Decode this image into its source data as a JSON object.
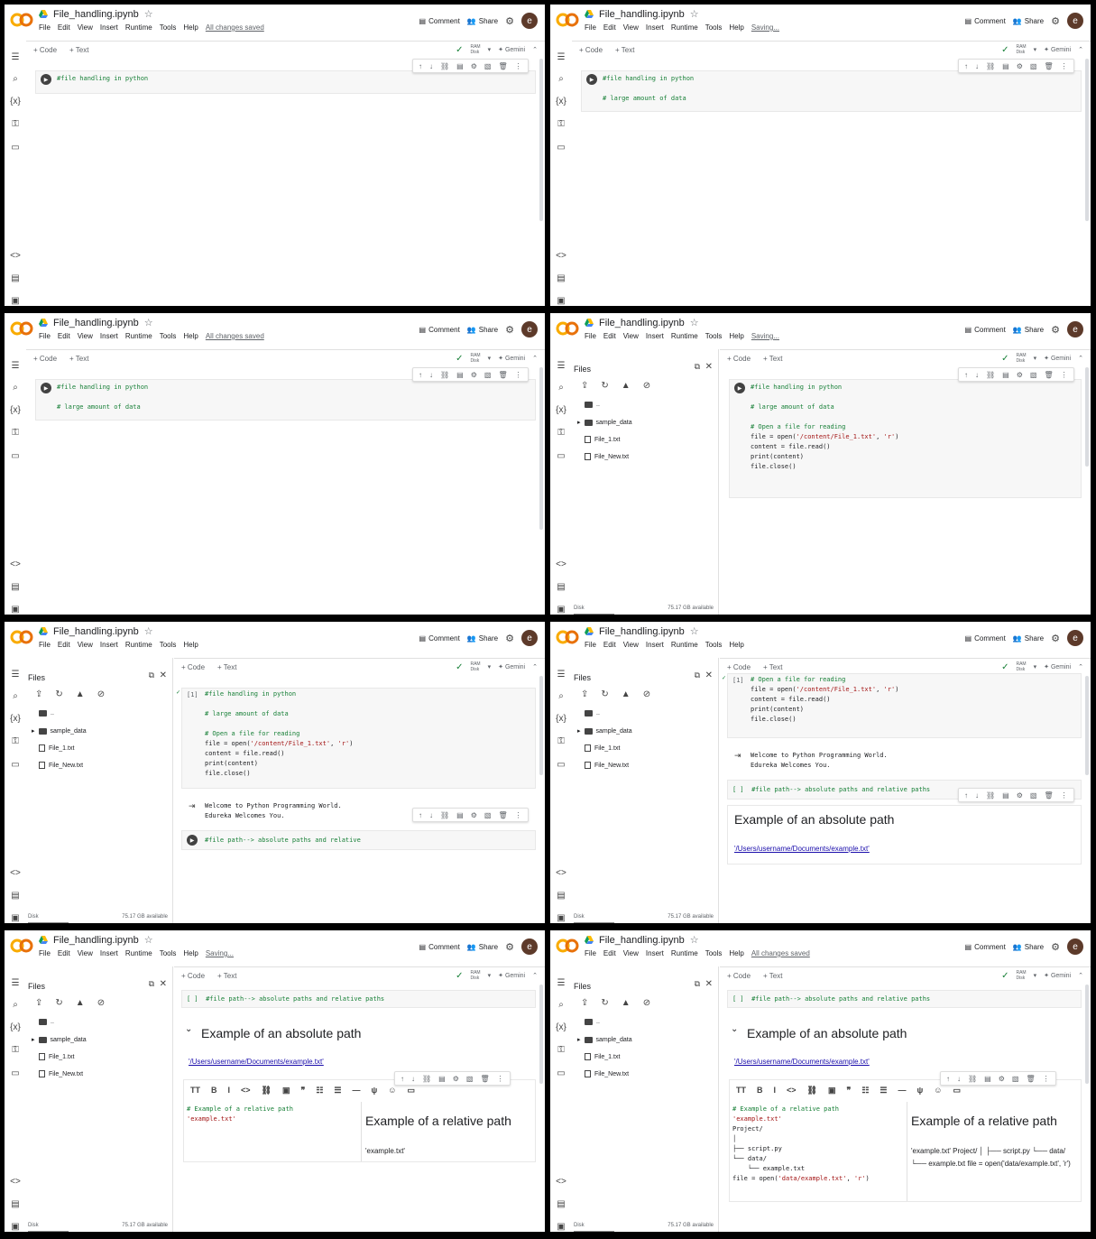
{
  "app": {
    "notebook_name": "File_handling.ipynb",
    "menus": [
      "File",
      "Edit",
      "View",
      "Insert",
      "Runtime",
      "Tools",
      "Help"
    ],
    "comment_label": "Comment",
    "share_label": "Share",
    "avatar_letter": "e",
    "add_code": "+ Code",
    "add_text": "+ Text",
    "gemini": "Gemini",
    "ram": "RAM",
    "disk": "Disk",
    "files_title": "Files",
    "disk_label": "Disk",
    "disk_available": "75.17 GB available",
    "file_items": [
      "..",
      "sample_data",
      "File_1.txt",
      "File_New.txt"
    ]
  },
  "panels": [
    {
      "save_status": "All changes saved",
      "cell_lines": [
        "#file handling in python "
      ]
    },
    {
      "save_status": "Saving...",
      "cell_lines": [
        "#file handling in python",
        "",
        "# large amount of data",
        ""
      ]
    },
    {
      "save_status": "All changes saved",
      "cell_lines": [
        "#file handling in python",
        "",
        "# large amount of data"
      ]
    },
    {
      "save_status": "Saving...",
      "cell_lines": [
        "#file handling in python",
        "",
        "# large amount of data",
        "",
        "# Open a file for reading",
        "file = open('/content/File_1.txt', 'r')",
        "content = file.read()",
        "print(content)",
        "file.close()"
      ]
    },
    {
      "save_status": "",
      "exec": "[1]",
      "cell_lines": [
        "#file handling in python",
        "",
        "# large amount of data",
        "",
        "# Open a file for reading",
        "file = open('/content/File_1.txt', 'r')",
        "content = file.read()",
        "print(content)",
        "file.close()"
      ],
      "output": [
        "Welcome to Python Programming World.",
        "Edureka Welcomes You."
      ],
      "next_cell": "#file path--> absolute paths and relative"
    },
    {
      "save_status": "",
      "exec": "[1]",
      "cell_lines": [
        "# Open a file for reading",
        "file = open('/content/File_1.txt', 'r')",
        "content = file.read()",
        "print(content)",
        "file.close()"
      ],
      "output": [
        "Welcome to Python Programming World.",
        "Edureka Welcomes You."
      ],
      "next_cell": "[ ]  #file path--> absolute paths and relative paths",
      "md_heading": "Example of an absolute path",
      "md_link": "'/Users/username/Documents/example.txt'"
    },
    {
      "save_status": "Saving...",
      "top_cell": "[ ]  #file path--> absolute paths and relative paths",
      "md_heading": "Example of an absolute path",
      "md_link": "'/Users/username/Documents/example.txt'",
      "edit_lines": [
        "# Example of a relative path",
        "'example.txt'"
      ],
      "preview_heading": "Example of a relative path",
      "preview_text": "'example.txt'"
    },
    {
      "save_status": "All changes saved",
      "top_cell": "[ ]  #file path--> absolute paths and relative paths",
      "md_heading": "Example of an absolute path",
      "md_link": "'/Users/username/Documents/example.txt'",
      "edit_lines": [
        "# Example of a relative path",
        "'example.txt'",
        "Project/",
        "│",
        "├── script.py",
        "└── data/",
        "    └── example.txt",
        "file = open('data/example.txt', 'r')"
      ],
      "preview_heading": "Example of a relative path",
      "preview_text": "'example.txt' Project/ │ ├── script.py └── data/ └── example.txt file = open('data/example.txt', 'r')"
    }
  ]
}
